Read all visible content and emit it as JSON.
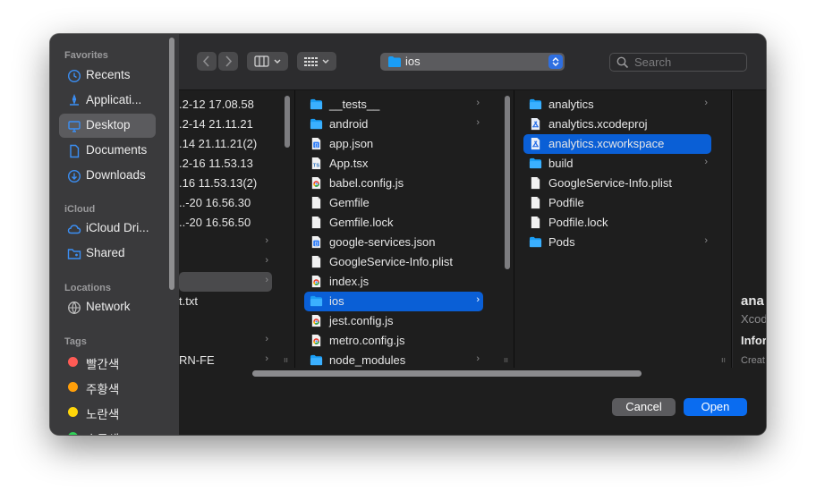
{
  "sidebar": {
    "favorites_header": "Favorites",
    "favorites": [
      {
        "label": "Recents",
        "icon": "clock-icon"
      },
      {
        "label": "Applicati...",
        "icon": "applications-icon"
      },
      {
        "label": "Desktop",
        "icon": "desktop-icon",
        "selected": true
      },
      {
        "label": "Documents",
        "icon": "document-icon"
      },
      {
        "label": "Downloads",
        "icon": "download-icon"
      }
    ],
    "icloud_header": "iCloud",
    "icloud": [
      {
        "label": "iCloud Dri...",
        "icon": "cloud-icon"
      },
      {
        "label": "Shared",
        "icon": "shared-folder-icon"
      }
    ],
    "locations_header": "Locations",
    "locations": [
      {
        "label": "Network",
        "icon": "network-icon"
      }
    ],
    "tags_header": "Tags",
    "tags": [
      {
        "label": "빨간색",
        "color": "#ff5b55"
      },
      {
        "label": "주황색",
        "color": "#ff9f0a"
      },
      {
        "label": "노란색",
        "color": "#ffd60a"
      },
      {
        "label": "초록색",
        "color": "#30d158"
      }
    ]
  },
  "toolbar": {
    "back_icon": "chevron-left-icon",
    "forward_icon": "chevron-right-icon",
    "view_icon": "columns-view-icon",
    "group_icon": "grid-icon",
    "path_label": "ios",
    "search_placeholder": "Search"
  },
  "column1": [
    {
      "label": ".2-12 17.08.58"
    },
    {
      "label": ".2-14 21.11.21"
    },
    {
      "label": ".14 21.11.21(2)"
    },
    {
      "label": ".2-16 11.53.13"
    },
    {
      "label": ".16 11.53.13(2)"
    },
    {
      "label": "..-20 16.56.30"
    },
    {
      "label": "..-20 16.56.50"
    },
    {
      "label": "",
      "arrow": true
    },
    {
      "label": "",
      "arrow": true
    },
    {
      "label": "",
      "arrow": true,
      "selected": true
    },
    {
      "label": "t.txt"
    },
    {
      "label": ""
    },
    {
      "label": "",
      "arrow": true
    },
    {
      "label": "RN-FE",
      "arrow": true
    }
  ],
  "column2": [
    {
      "label": "__tests__",
      "icon": "folder",
      "arrow": true
    },
    {
      "label": "android",
      "icon": "folder",
      "arrow": true
    },
    {
      "label": "app.json",
      "icon": "json"
    },
    {
      "label": "App.tsx",
      "icon": "ts"
    },
    {
      "label": "babel.config.js",
      "icon": "chrome"
    },
    {
      "label": "Gemfile",
      "icon": "doc"
    },
    {
      "label": "Gemfile.lock",
      "icon": "doc"
    },
    {
      "label": "google-services.json",
      "icon": "json"
    },
    {
      "label": "GoogleService-Info.plist",
      "icon": "doc"
    },
    {
      "label": "index.js",
      "icon": "chrome"
    },
    {
      "label": "ios",
      "icon": "folder",
      "arrow": true,
      "selected": true
    },
    {
      "label": "jest.config.js",
      "icon": "chrome"
    },
    {
      "label": "metro.config.js",
      "icon": "chrome"
    },
    {
      "label": "node_modules",
      "icon": "folder",
      "arrow": true
    }
  ],
  "column3": [
    {
      "label": "analytics",
      "icon": "folder",
      "arrow": true
    },
    {
      "label": "analytics.xcodeproj",
      "icon": "xcode"
    },
    {
      "label": "analytics.xcworkspace",
      "icon": "xcode",
      "selected": true
    },
    {
      "label": "build",
      "icon": "folder",
      "arrow": true
    },
    {
      "label": "GoogleService-Info.plist",
      "icon": "doc"
    },
    {
      "label": "Podfile",
      "icon": "doc"
    },
    {
      "label": "Podfile.lock",
      "icon": "doc"
    },
    {
      "label": "Pods",
      "icon": "folder",
      "arrow": true
    }
  ],
  "preview": {
    "name": "ana",
    "kind": "Xcod",
    "info_header": "Infor",
    "created_label": "Creat"
  },
  "buttons": {
    "cancel": "Cancel",
    "open": "Open"
  },
  "colors": {
    "accent": "#0a5fd6",
    "folder": "#1a9df5",
    "selection_inactive": "#4a4a4c"
  }
}
